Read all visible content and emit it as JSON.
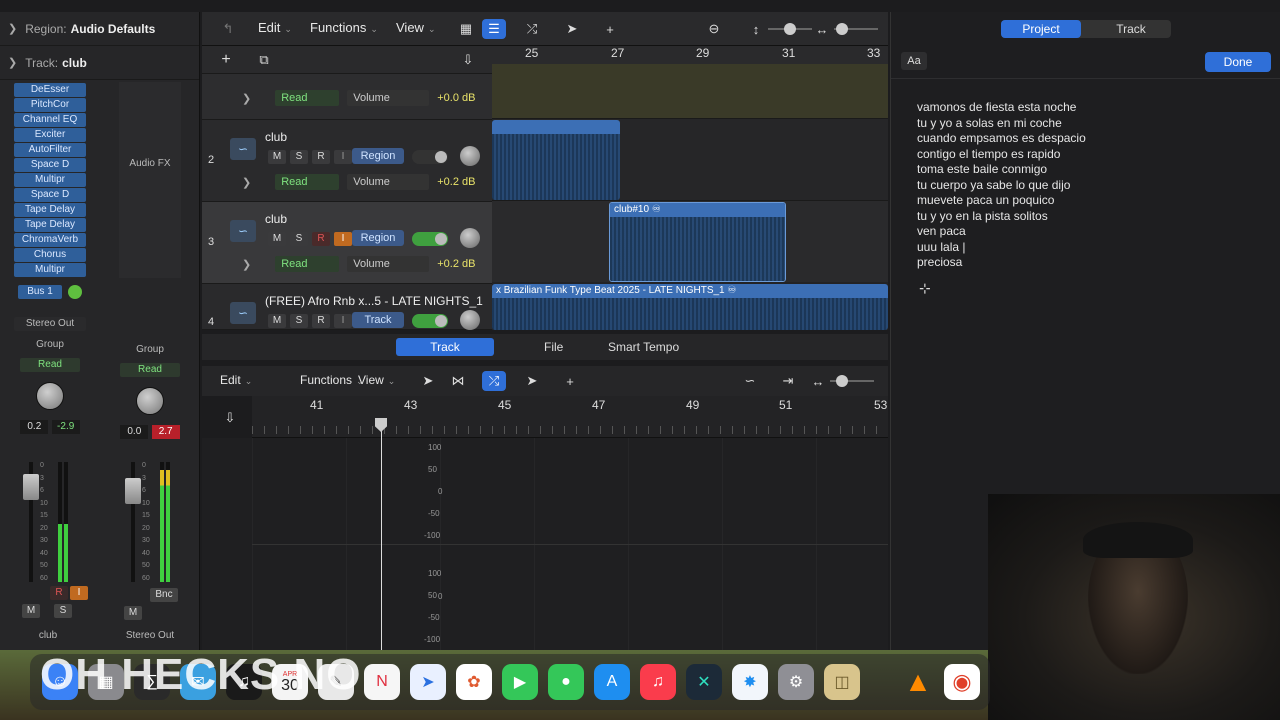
{
  "inspector": {
    "region_label": "Region:",
    "region_value": "Audio Defaults",
    "track_label": "Track:",
    "track_value": "club",
    "plugins": [
      "DeEsser",
      "PitchCor",
      "Channel EQ",
      "Exciter",
      "AutoFilter",
      "Space D",
      "Multipr",
      "Space D",
      "Tape Delay",
      "Tape Delay",
      "ChromaVerb",
      "Chorus",
      "Multipr"
    ],
    "audio_fx": "Audio FX",
    "bus": "Bus 1",
    "stereo_out": "Stereo Out",
    "group": "Group",
    "read": "Read",
    "strip1": {
      "val_a": "0.2",
      "val_b": "-2.9",
      "name": "club",
      "m": "M",
      "s": "S",
      "r": "R",
      "i": "I"
    },
    "strip2": {
      "val_a": "0.0",
      "val_b": "2.7",
      "name": "Stereo Out",
      "m": "M",
      "bnc": "Bnc"
    },
    "scale": [
      "0",
      "3",
      "6",
      "10",
      "15",
      "20",
      "30",
      "40",
      "50",
      "60"
    ]
  },
  "toolbar": {
    "edit": "Edit",
    "functions": "Functions",
    "view": "View"
  },
  "tracks": [
    {
      "num": "",
      "name": "",
      "read": "Read",
      "param": "Volume",
      "db": "+0.0 dB"
    },
    {
      "num": "2",
      "name": "club",
      "m": "M",
      "s": "S",
      "r": "R",
      "i": "I",
      "mode": "Region",
      "read": "Read",
      "param": "Volume",
      "db": "+0.2 dB"
    },
    {
      "num": "3",
      "name": "club",
      "m": "M",
      "s": "S",
      "r": "R",
      "i": "I",
      "mode": "Region",
      "read": "Read",
      "param": "Volume",
      "db": "+0.2 dB"
    },
    {
      "num": "4",
      "name": "(FREE) Afro Rnb x...5 - LATE NIGHTS_1",
      "m": "M",
      "s": "S",
      "r": "R",
      "i": "I",
      "mode": "Track"
    }
  ],
  "ruler_top": [
    "25",
    "27",
    "29",
    "31",
    "33"
  ],
  "regions": {
    "club10": "club#10",
    "long": "x Brazilian Funk Type Beat 2025 - LATE NIGHTS_1"
  },
  "editor": {
    "tabs": [
      "Track",
      "File",
      "Smart Tempo"
    ],
    "edit": "Edit",
    "functions": "Functions",
    "view": "View",
    "ruler": [
      "41",
      "43",
      "45",
      "47",
      "49",
      "51",
      "53"
    ],
    "scale": [
      "100",
      "50",
      "0",
      "-50",
      "-100",
      "100",
      "50",
      "0",
      "-50",
      "-100"
    ]
  },
  "right_panel": {
    "tabs": [
      "Project",
      "Track"
    ],
    "aa": "Aa",
    "done": "Done",
    "lyrics": [
      "vamonos de fiesta esta noche",
      "tu y yo a solas en mi coche",
      "cuando empsamos es despacio",
      "contigo el tiempo es rapido",
      "toma este baile conmigo",
      "tu cuerpo ya sabe lo que dijo",
      "muevete paca un poquico",
      "tu y yo en la pista solitos",
      "ven paca",
      "uuu lala |",
      "preciosa"
    ]
  },
  "overlay": "OH HECKS NO",
  "dock": {
    "calendar_month": "APR",
    "calendar_day": "30"
  },
  "colors": {
    "accent": "#2f6fd8",
    "region": "#3c6fb5",
    "read_green": "#7fe27f",
    "db_yellow": "#e9e36a"
  }
}
